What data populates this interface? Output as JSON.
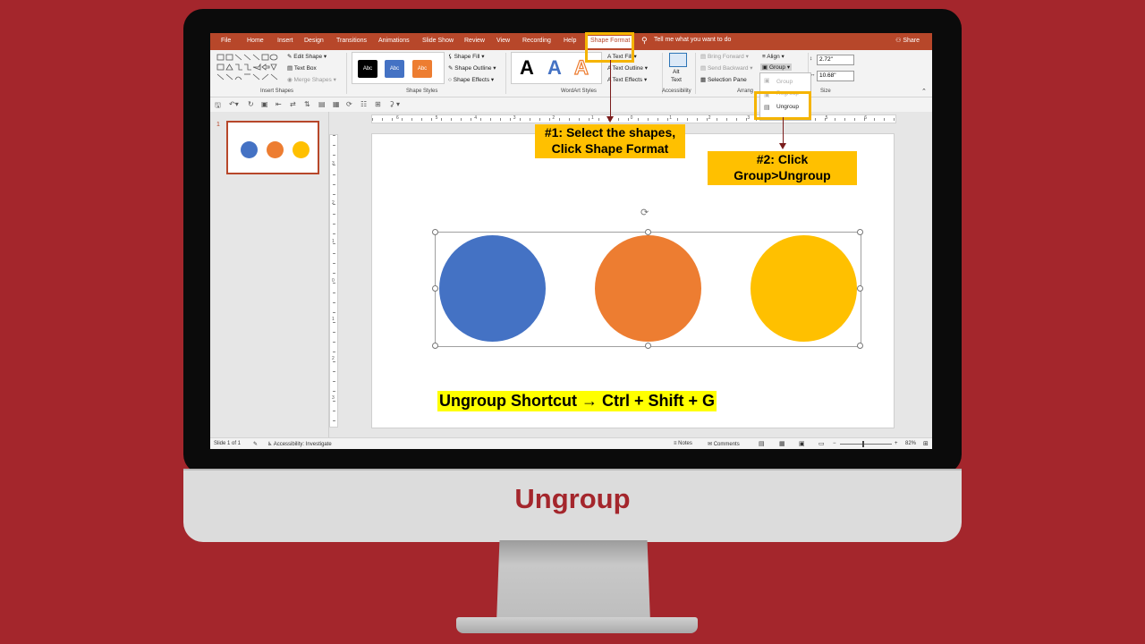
{
  "caption": "Ungroup",
  "ribbon_tabs": [
    "File",
    "Home",
    "Insert",
    "Design",
    "Transitions",
    "Animations",
    "Slide Show",
    "Review",
    "View",
    "Recording",
    "Help"
  ],
  "active_tab": "Shape Format",
  "tell_me": "Tell me what you want to do",
  "share": "Share",
  "insert_shapes": {
    "edit_shape": "Edit Shape",
    "text_box": "Text Box",
    "merge_shapes": "Merge Shapes",
    "label": "Insert Shapes"
  },
  "shape_styles": {
    "swatch_text": "Abc",
    "fill": "Shape Fill",
    "outline": "Shape Outline",
    "effects": "Shape Effects",
    "label": "Shape Styles"
  },
  "wordart": {
    "letter": "A",
    "text_fill": "Text Fill",
    "text_outline": "Text Outline",
    "text_effects": "Text Effects",
    "label": "WordArt Styles"
  },
  "accessibility": {
    "alt_line1": "Alt",
    "alt_line2": "Text",
    "label": "Accessibility"
  },
  "arrange": {
    "bring_forward": "Bring Forward",
    "send_backward": "Send Backward",
    "selection_pane": "Selection Pane",
    "align": "Align",
    "group": "Group",
    "label": "Arrang"
  },
  "size": {
    "height": "2.72\"",
    "width": "10.68\"",
    "label": "Size"
  },
  "group_menu": {
    "group": "Group",
    "regroup": "Regroup",
    "ungroup": "Ungroup"
  },
  "slide_number": "1",
  "ruler": {
    "h": [
      "6",
      "5",
      "4",
      "3",
      "2",
      "1",
      "0",
      "1",
      "2",
      "3",
      "4",
      "5",
      "6"
    ],
    "v": [
      "3",
      "2",
      "1",
      "0",
      "1",
      "2",
      "3"
    ]
  },
  "shortcut_text": "Ungroup  Shortcut  → Ctrl + Shift + G",
  "callout1": {
    "line1": "#1: Select the shapes,",
    "line2": "Click Shape Format"
  },
  "callout2": {
    "line1": "#2: Click",
    "line2": "Group>Ungroup"
  },
  "status": {
    "slide": "Slide 1 of 1",
    "accessibility": "Accessibility: Investigate",
    "notes": "Notes",
    "comments": "Comments",
    "zoom": "82%"
  },
  "colors": {
    "blue": "#4472c4",
    "orange": "#ed7d31",
    "gold": "#ffc000",
    "accent": "#b7472a"
  }
}
